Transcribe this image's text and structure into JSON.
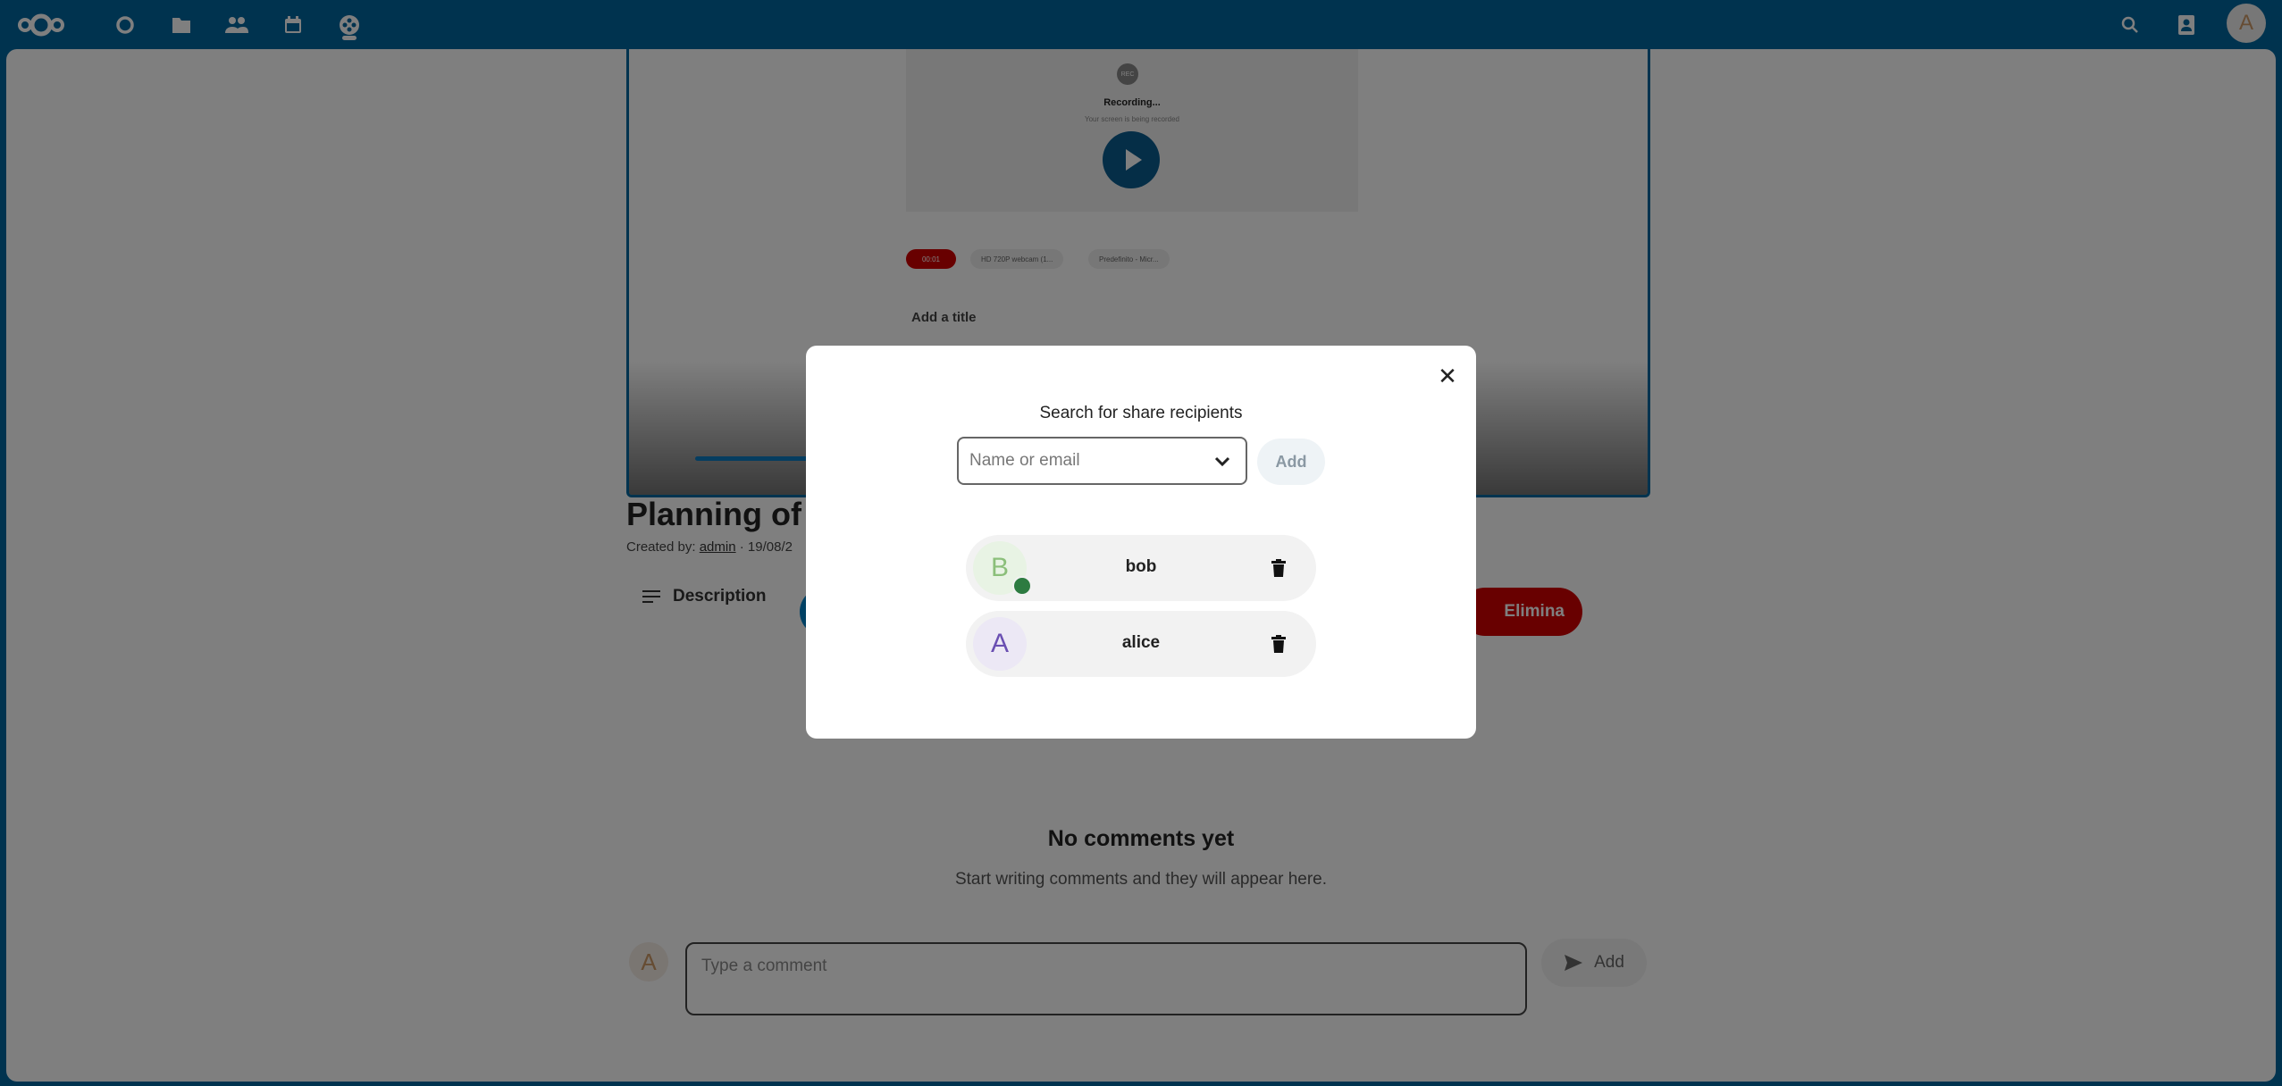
{
  "topbar": {
    "icons": [
      "nextcloud-logo-icon",
      "dashboard-icon",
      "files-icon",
      "contacts-icon",
      "calendar-icon",
      "video-icon"
    ],
    "right_icons": [
      "search-icon",
      "contacts-menu-icon"
    ],
    "user_initial": "A"
  },
  "video": {
    "rec_badge": "REC",
    "recording_label": "Recording...",
    "recording_sub": "Your screen is being recorded",
    "timer": "00:01",
    "camera_label": "HD 720P webcam (1...",
    "mic_label": "Predefinito - Micr...",
    "add_title": "Add a title"
  },
  "page": {
    "title": "Planning of",
    "created_prefix": "Created by:",
    "created_by": "admin",
    "created_date": "· 19/08/2",
    "description_tab": "Description",
    "delete_label": "Elimina"
  },
  "comments": {
    "empty_title": "No comments yet",
    "empty_sub": "Start writing comments and they will appear here.",
    "placeholder": "Type a comment",
    "add_label": "Add",
    "avatar_initial": "A"
  },
  "modal": {
    "heading": "Search for share recipients",
    "search_placeholder": "Name or email",
    "add_label": "Add",
    "close_symbol": "✕",
    "recipients": [
      {
        "initial": "B",
        "name": "bob",
        "avatar_bg": "#e8f3e4",
        "avatar_fg": "#8bbf7a",
        "online": true
      },
      {
        "initial": "A",
        "name": "alice",
        "avatar_bg": "#ece8f5",
        "avatar_fg": "#6a4fb2",
        "online": false
      }
    ]
  }
}
